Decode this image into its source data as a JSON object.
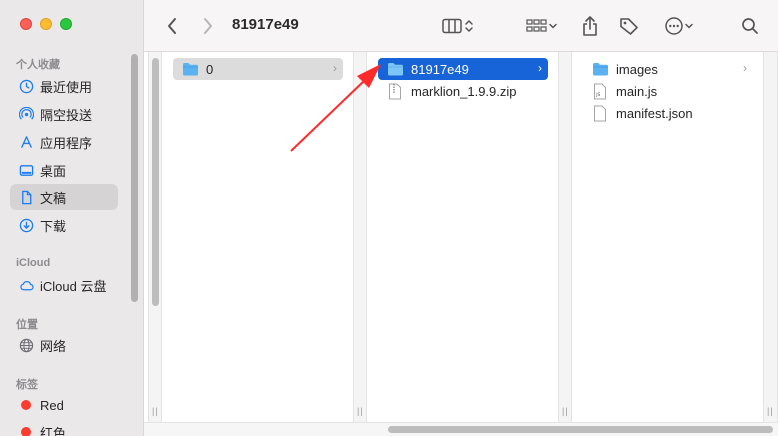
{
  "window": {
    "title": "81917e49"
  },
  "sidebar": {
    "sections": {
      "favorites": "个人收藏",
      "icloud": "iCloud",
      "locations": "位置",
      "tags": "标签"
    },
    "favorites": [
      {
        "label": "最近使用",
        "icon": "clock-icon"
      },
      {
        "label": "隔空投送",
        "icon": "airdrop-icon"
      },
      {
        "label": "应用程序",
        "icon": "applications-icon"
      },
      {
        "label": "桌面",
        "icon": "desktop-icon"
      },
      {
        "label": "文稿",
        "icon": "document-icon",
        "selected": true
      },
      {
        "label": "下载",
        "icon": "download-icon"
      }
    ],
    "icloud_items": [
      {
        "label": "iCloud 云盘",
        "icon": "cloud-icon"
      }
    ],
    "locations_items": [
      {
        "label": "网络",
        "icon": "network-icon"
      }
    ],
    "tags_items": [
      {
        "label": "Red",
        "color": "#ff3b30"
      },
      {
        "label": "红色",
        "color": "#ff3b30"
      }
    ]
  },
  "columns": {
    "col1": [
      {
        "name": "0",
        "type": "folder",
        "selected": "gray",
        "has_children": true
      }
    ],
    "col2": [
      {
        "name": "81917e49",
        "type": "folder",
        "selected": "blue",
        "has_children": true
      },
      {
        "name": "marklion_1.9.9.zip",
        "type": "zip",
        "selected": "none",
        "has_children": false
      }
    ],
    "col3": [
      {
        "name": "images",
        "type": "folder",
        "has_children": true
      },
      {
        "name": "main.js",
        "type": "file",
        "has_children": false
      },
      {
        "name": "manifest.json",
        "type": "file",
        "has_children": false
      }
    ]
  },
  "colors": {
    "accent": "#1764d8",
    "arrow": "#ff2a2a",
    "folder": "#5ab2f0"
  }
}
